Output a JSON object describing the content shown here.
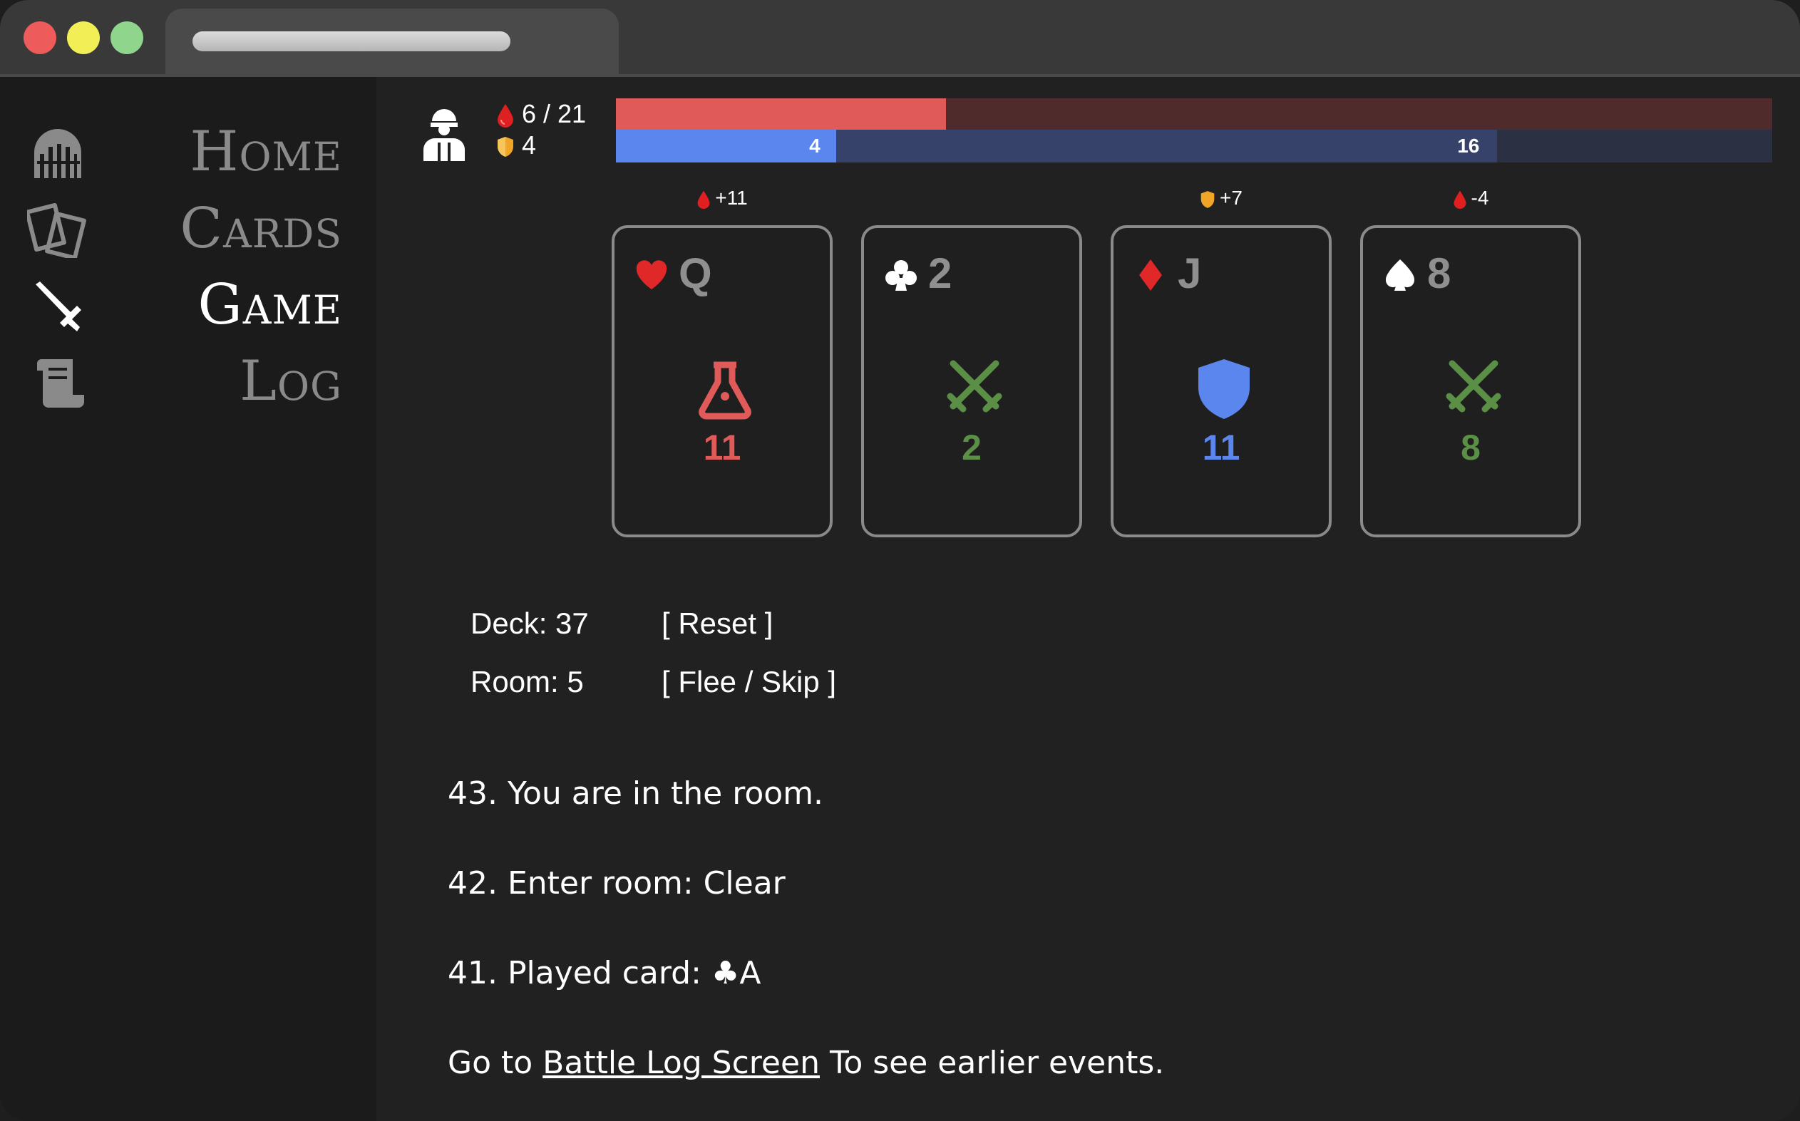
{
  "nav": {
    "items": [
      {
        "label": "Home",
        "icon": "dungeon-gate-icon"
      },
      {
        "label": "Cards",
        "icon": "cards-icon"
      },
      {
        "label": "Game",
        "icon": "sword-icon",
        "active": true
      },
      {
        "label": "Log",
        "icon": "scroll-icon"
      }
    ]
  },
  "player": {
    "icon": "hero-icon",
    "health_text": "6 / 21",
    "health": 6,
    "health_max": 21,
    "shield_text": "4",
    "shield": 4,
    "shield_durability": 16,
    "shield_bar_label": "4",
    "durability_bar_label": "16",
    "colors": {
      "health": "#e05a5a",
      "shield": "#5b86ee"
    }
  },
  "cards": [
    {
      "effect": "+11",
      "effect_icon": "blood-drop-icon",
      "suit": "hearts",
      "suit_glyph": "♥",
      "rank": "Q",
      "icon": "potion-icon",
      "value": "11",
      "color": "#e05a5a"
    },
    {
      "effect": "",
      "effect_icon": "",
      "suit": "clubs",
      "suit_glyph": "♣",
      "rank": "2",
      "icon": "crossed-swords-icon",
      "value": "2",
      "color": "#5a8f45"
    },
    {
      "effect": "+7",
      "effect_icon": "shield-icon",
      "suit": "diamonds",
      "suit_glyph": "♦",
      "rank": "J",
      "icon": "shield-icon",
      "value": "11",
      "color": "#5b86ee"
    },
    {
      "effect": "-4",
      "effect_icon": "blood-drop-icon",
      "suit": "spades",
      "suit_glyph": "♠",
      "rank": "8",
      "icon": "crossed-swords-icon",
      "value": "8",
      "color": "#5a8f45"
    }
  ],
  "status": {
    "deck": "Deck: 37",
    "room": "Room: 5",
    "reset": "[ Reset ]",
    "flee": "[ Flee / Skip ]"
  },
  "log": {
    "entries": [
      "43. You are in the room.",
      "42. Enter room: Clear",
      "41. Played card: ♣A"
    ],
    "footer_prefix": "Go to ",
    "footer_link": "Battle Log Screen",
    "footer_suffix": " To see earlier events."
  }
}
